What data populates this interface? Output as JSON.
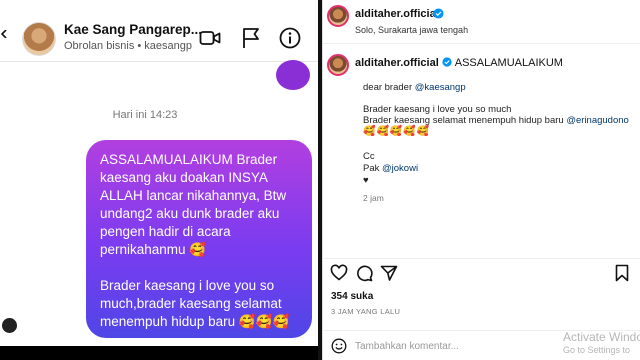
{
  "dm": {
    "contact_name": "Kae Sang Pangarep...",
    "contact_sub": "Obrolan bisnis • kaesangp",
    "timestamp": "Hari ini 14:23",
    "message_part1": "ASSALAMUALAIKUM Brader kaesang aku doakan INSYA ALLAH lancar nikahannya, Btw undang2 aku dunk brader aku pengen hadir di acara pernikahanmu",
    "emoji1": "🥰",
    "message_part2": "Brader kaesang i love you so much,brader kaesang selamat menempuh hidup baru",
    "emoji2": "🥰🥰🥰"
  },
  "post": {
    "username": "alditaher.official",
    "location": "Solo, Surakarta jawa tengah",
    "caption_head_user": "alditaher.official",
    "caption_head_text": "ASSALAMUALAIKUM",
    "line_dear": "dear brader",
    "mention_kaesang": "@kaesangp",
    "line_love": "Brader kaesang i love you so much",
    "line_selamat": "Brader kaesang selamat menempuh hidup baru",
    "mention_erina": "@erinagudono",
    "hearts": "🥰🥰🥰🥰🥰",
    "cc": "Cc",
    "pak": "Pak",
    "mention_jokowi": "@jokowi",
    "heart": "♥",
    "time_ago": "2 jam",
    "likes": "354 suka",
    "posted": "3 JAM YANG LALU",
    "comment_placeholder": "Tambahkan komentar...",
    "watermark_line1": "Activate Windo",
    "watermark_line2": "Go to Settings to"
  },
  "colors": {
    "bubble_top": "#b23fe0",
    "bubble_bottom": "#4f46e6",
    "verified": "#0095f6",
    "mention": "#00376b"
  },
  "icons": [
    "back-icon",
    "video-icon",
    "flag-icon",
    "info-icon",
    "verified-icon",
    "heart-icon",
    "comment-icon",
    "share-icon",
    "bookmark-icon",
    "smile-icon"
  ]
}
